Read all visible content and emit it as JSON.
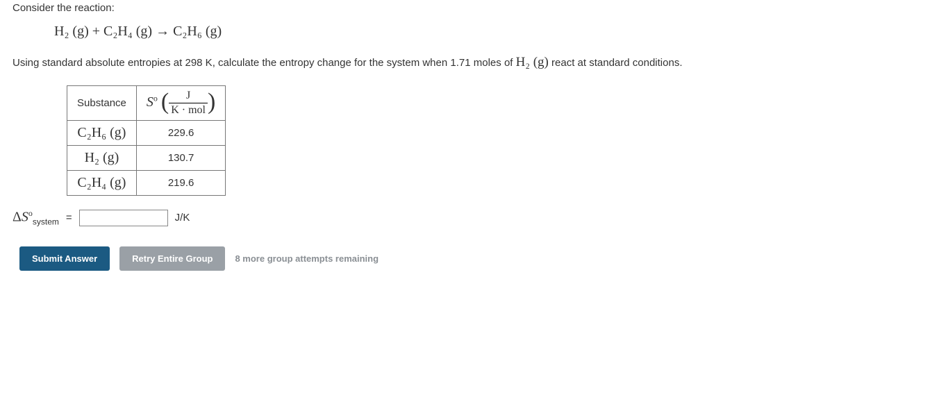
{
  "intro": "Consider the reaction:",
  "reaction": {
    "reactants": [
      "H₂ (g)",
      "C₂H₄ (g)"
    ],
    "product": "C₂H₆ (g)",
    "plus": " + ",
    "arrow": " → "
  },
  "instruction_parts": {
    "before_moles": "Using standard absolute entropies at 298 K, calculate the entropy change for the system when ",
    "moles": "1.71",
    "after_moles": " moles of ",
    "species": "H₂ (g)",
    "tail": " react at standard conditions."
  },
  "table": {
    "headers": {
      "substance": "Substance",
      "s_symbol": "S",
      "s_super": "o",
      "unit_num": "J",
      "unit_den": "K · mol"
    },
    "rows": [
      {
        "substance": "C₂H₆ (g)",
        "value": "229.6"
      },
      {
        "substance": "H₂ (g)",
        "value": "130.7"
      },
      {
        "substance": "C₂H₄ (g)",
        "value": "219.6"
      }
    ]
  },
  "answer": {
    "label_delta": "Δ",
    "label_S": "S",
    "label_super": "o",
    "label_sub": "system",
    "equals": "=",
    "unit": "J/K",
    "value": ""
  },
  "buttons": {
    "submit": "Submit Answer",
    "retry": "Retry Entire Group"
  },
  "attempts_text": "8 more group attempts remaining"
}
